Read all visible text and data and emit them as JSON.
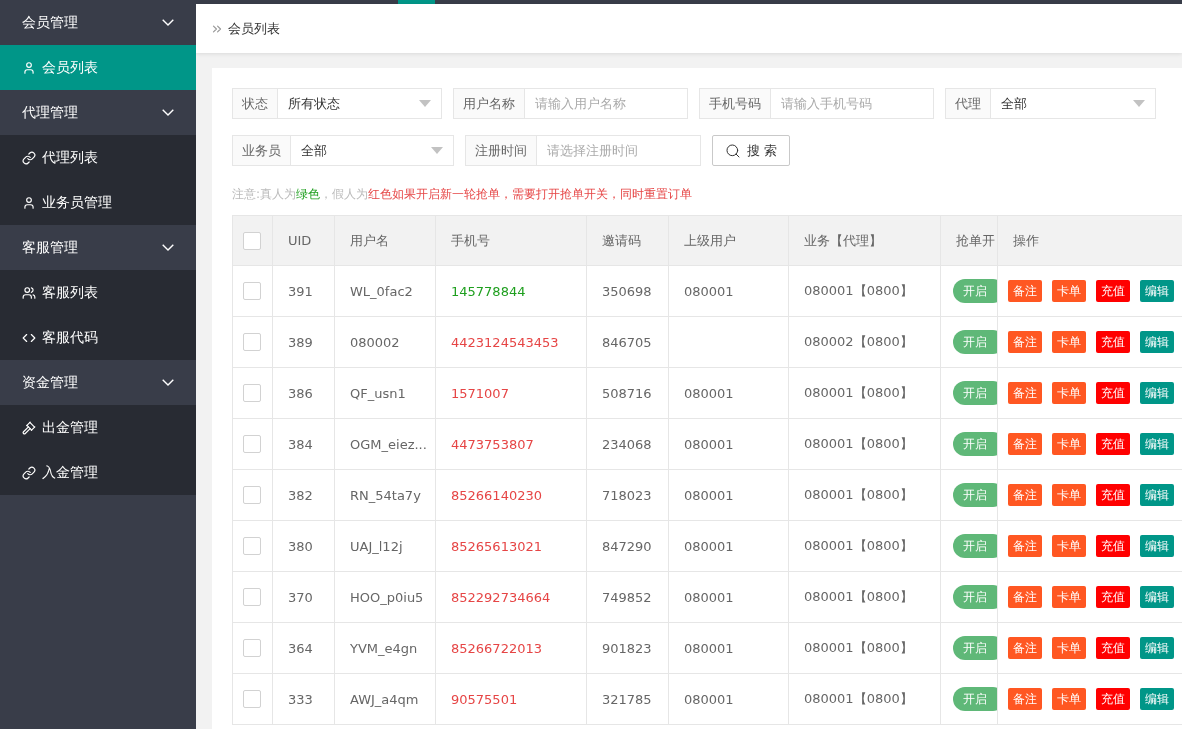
{
  "sidebar": {
    "groups": [
      {
        "label": "会员管理",
        "expanded": true,
        "items": [
          {
            "label": "会员列表",
            "selected": true
          }
        ]
      },
      {
        "label": "代理管理",
        "expanded": true,
        "items": [
          {
            "label": "代理列表",
            "selected": false
          },
          {
            "label": "业务员管理",
            "selected": false
          }
        ]
      },
      {
        "label": "客服管理",
        "expanded": true,
        "items": [
          {
            "label": "客服列表",
            "selected": false
          },
          {
            "label": "客服代码",
            "selected": false
          }
        ]
      },
      {
        "label": "资金管理",
        "expanded": true,
        "items": [
          {
            "label": "出金管理",
            "selected": false
          },
          {
            "label": "入金管理",
            "selected": false
          }
        ]
      }
    ]
  },
  "breadcrumb": "会员列表",
  "filters": [
    {
      "label": "状态",
      "kind": "select",
      "value": "所有状态"
    },
    {
      "label": "用户名称",
      "kind": "input",
      "placeholder": "请输入用户名称"
    },
    {
      "label": "手机号码",
      "kind": "input",
      "placeholder": "请输入手机号码"
    },
    {
      "label": "代理",
      "kind": "select",
      "value": "全部"
    },
    {
      "label": "业务员",
      "kind": "select",
      "value": "全部"
    },
    {
      "label": "注册时间",
      "kind": "input",
      "placeholder": "请选择注册时间"
    }
  ],
  "search_button": "搜 索",
  "notice": [
    {
      "kind": "muted",
      "text": "注意:真人为"
    },
    {
      "kind": "green",
      "text": "绿色"
    },
    {
      "kind": "muted",
      "text": "，假人为"
    },
    {
      "kind": "red",
      "text": "红色如果开启新一轮抢单，需要打开抢单开关，同时重置订单"
    }
  ],
  "table": {
    "select_all": {
      "checked": false
    },
    "columns": [
      "UID",
      "用户名",
      "手机号",
      "邀请码",
      "上级用户",
      "业务【代理】",
      "抢单开",
      "操作"
    ],
    "rows": [
      {
        "checked": false,
        "uid": "391",
        "username": "WL_0fac2",
        "phone": "145778844",
        "real": true,
        "invite": "350698",
        "parent": "080001",
        "agent": "080001【0800】",
        "switch": {
          "label": "开启",
          "on": true
        },
        "actions": [
          {
            "label": "备注",
            "kind": "note"
          },
          {
            "label": "卡单",
            "kind": "block"
          },
          {
            "label": "充值",
            "kind": "recharge"
          },
          {
            "label": "编辑",
            "kind": "edit"
          }
        ]
      },
      {
        "checked": false,
        "uid": "389",
        "username": "080002",
        "phone": "4423124543453",
        "real": false,
        "invite": "846705",
        "parent": "",
        "agent": "080002【0800】",
        "switch": {
          "label": "开启",
          "on": true
        },
        "actions": [
          {
            "label": "备注",
            "kind": "note"
          },
          {
            "label": "卡单",
            "kind": "block"
          },
          {
            "label": "充值",
            "kind": "recharge"
          },
          {
            "label": "编辑",
            "kind": "edit"
          }
        ]
      },
      {
        "checked": false,
        "uid": "386",
        "username": "QF_usn1",
        "phone": "1571007",
        "real": false,
        "invite": "508716",
        "parent": "080001",
        "agent": "080001【0800】",
        "switch": {
          "label": "开启",
          "on": true
        },
        "actions": [
          {
            "label": "备注",
            "kind": "note"
          },
          {
            "label": "卡单",
            "kind": "block"
          },
          {
            "label": "充值",
            "kind": "recharge"
          },
          {
            "label": "编辑",
            "kind": "edit"
          }
        ]
      },
      {
        "checked": false,
        "uid": "384",
        "username": "OGM_eiez...",
        "phone": "4473753807",
        "real": false,
        "invite": "234068",
        "parent": "080001",
        "agent": "080001【0800】",
        "switch": {
          "label": "开启",
          "on": true
        },
        "actions": [
          {
            "label": "备注",
            "kind": "note"
          },
          {
            "label": "卡单",
            "kind": "block"
          },
          {
            "label": "充值",
            "kind": "recharge"
          },
          {
            "label": "编辑",
            "kind": "edit"
          }
        ]
      },
      {
        "checked": false,
        "uid": "382",
        "username": "RN_54ta7y",
        "phone": "85266140230",
        "real": false,
        "invite": "718023",
        "parent": "080001",
        "agent": "080001【0800】",
        "switch": {
          "label": "开启",
          "on": true
        },
        "actions": [
          {
            "label": "备注",
            "kind": "note"
          },
          {
            "label": "卡单",
            "kind": "block"
          },
          {
            "label": "充值",
            "kind": "recharge"
          },
          {
            "label": "编辑",
            "kind": "edit"
          }
        ]
      },
      {
        "checked": false,
        "uid": "380",
        "username": "UAJ_l12j",
        "phone": "85265613021",
        "real": false,
        "invite": "847290",
        "parent": "080001",
        "agent": "080001【0800】",
        "switch": {
          "label": "开启",
          "on": true
        },
        "actions": [
          {
            "label": "备注",
            "kind": "note"
          },
          {
            "label": "卡单",
            "kind": "block"
          },
          {
            "label": "充值",
            "kind": "recharge"
          },
          {
            "label": "编辑",
            "kind": "edit"
          }
        ]
      },
      {
        "checked": false,
        "uid": "370",
        "username": "HOO_p0iu5",
        "phone": "852292734664",
        "real": false,
        "invite": "749852",
        "parent": "080001",
        "agent": "080001【0800】",
        "switch": {
          "label": "开启",
          "on": true
        },
        "actions": [
          {
            "label": "备注",
            "kind": "note"
          },
          {
            "label": "卡单",
            "kind": "block"
          },
          {
            "label": "充值",
            "kind": "recharge"
          },
          {
            "label": "编辑",
            "kind": "edit"
          }
        ]
      },
      {
        "checked": false,
        "uid": "364",
        "username": "YVM_e4gn",
        "phone": "85266722013",
        "real": false,
        "invite": "901823",
        "parent": "080001",
        "agent": "080001【0800】",
        "switch": {
          "label": "开启",
          "on": true
        },
        "actions": [
          {
            "label": "备注",
            "kind": "note"
          },
          {
            "label": "卡单",
            "kind": "block"
          },
          {
            "label": "充值",
            "kind": "recharge"
          },
          {
            "label": "编辑",
            "kind": "edit"
          }
        ]
      },
      {
        "checked": false,
        "uid": "333",
        "username": "AWJ_a4qm",
        "phone": "90575501",
        "real": false,
        "invite": "321785",
        "parent": "080001",
        "agent": "080001【0800】",
        "switch": {
          "label": "开启",
          "on": true
        },
        "actions": [
          {
            "label": "备注",
            "kind": "note"
          },
          {
            "label": "卡单",
            "kind": "block"
          },
          {
            "label": "充值",
            "kind": "recharge"
          },
          {
            "label": "编辑",
            "kind": "edit"
          }
        ]
      }
    ]
  }
}
